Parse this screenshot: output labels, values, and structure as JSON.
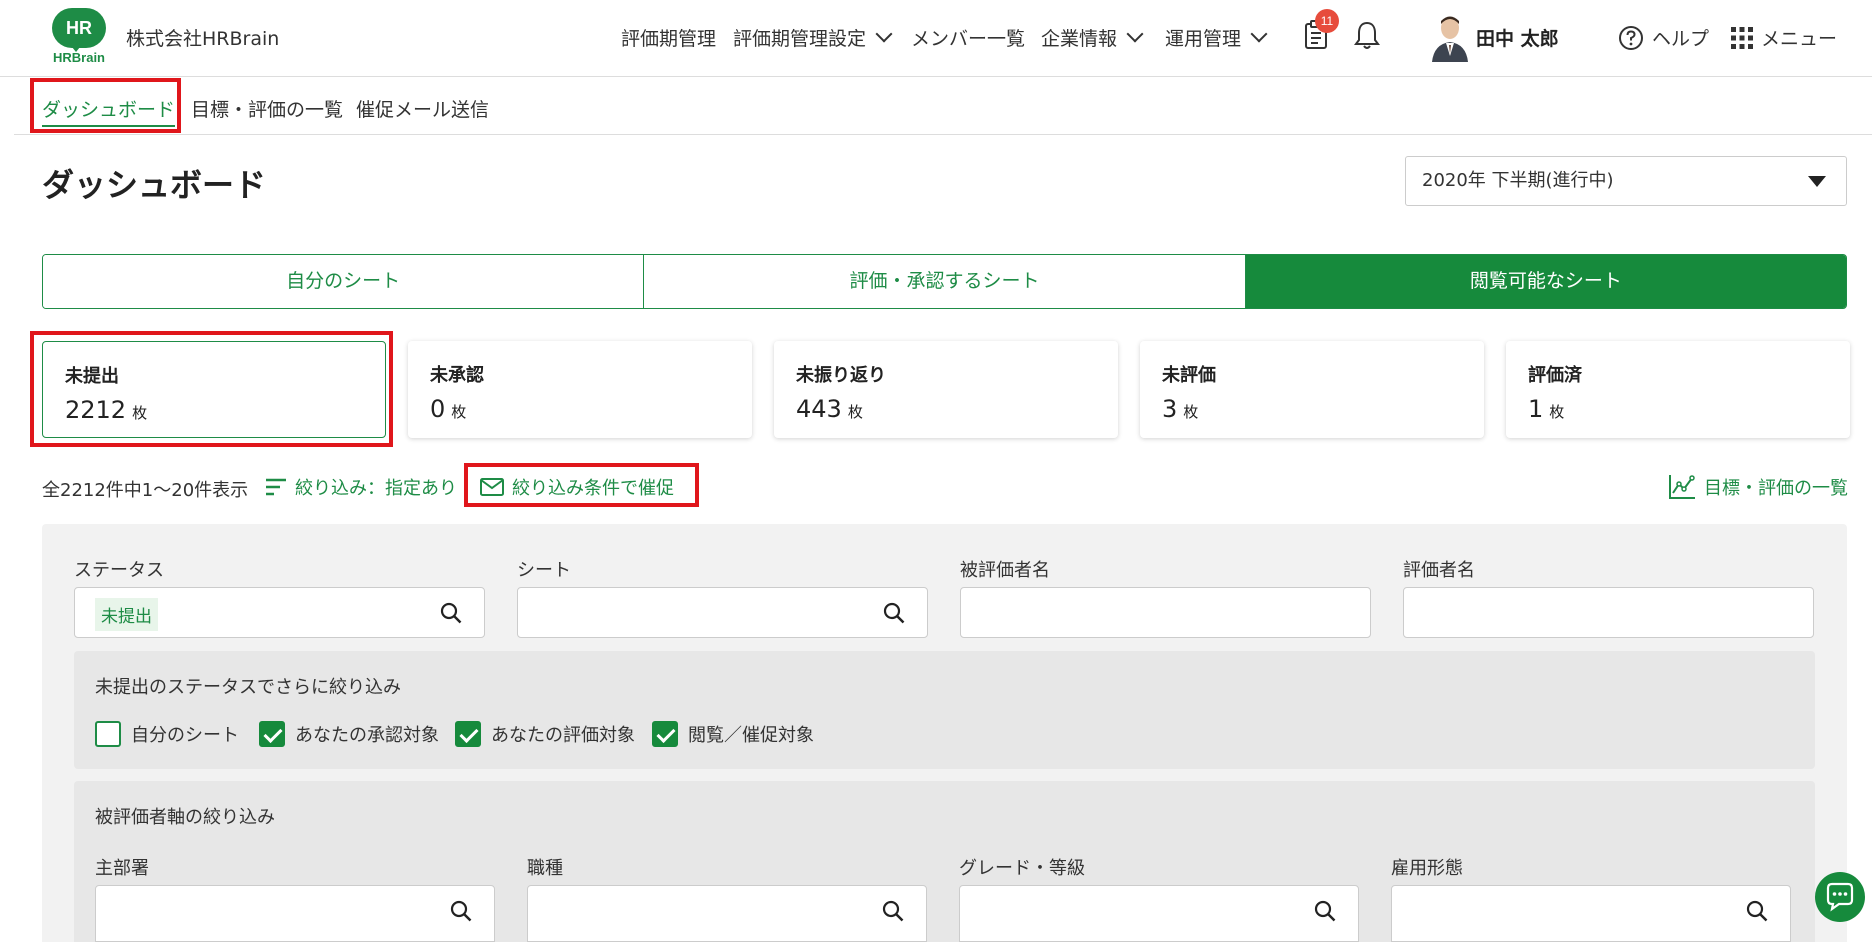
{
  "header": {
    "logo_text": "HR",
    "logo_sub": "HRBrain",
    "company": "株式会社HRBrain",
    "nav": [
      {
        "label": "評価期管理"
      },
      {
        "label": "評価期管理設定"
      },
      {
        "label": "メンバー一覧"
      },
      {
        "label": "企業情報"
      },
      {
        "label": "運用管理"
      }
    ],
    "notification_count": "11",
    "user_name": "田中 太郎",
    "help_label": "ヘルプ",
    "menu_label": "メニュー"
  },
  "subnav": {
    "items": [
      {
        "label": "ダッシュボード"
      },
      {
        "label": "目標・評価の一覧"
      },
      {
        "label": "催促メール送信"
      }
    ]
  },
  "page": {
    "title": "ダッシュボード",
    "period": "2020年 下半期(進行中)"
  },
  "tabs": [
    {
      "label": "自分のシート"
    },
    {
      "label": "評価・承認するシート"
    },
    {
      "label": "閲覧可能なシート"
    }
  ],
  "cards": [
    {
      "label": "未提出",
      "count": "2212",
      "unit": "枚"
    },
    {
      "label": "未承認",
      "count": "0",
      "unit": "枚"
    },
    {
      "label": "未振り返り",
      "count": "443",
      "unit": "枚"
    },
    {
      "label": "未評価",
      "count": "3",
      "unit": "枚"
    },
    {
      "label": "評価済",
      "count": "1",
      "unit": "枚"
    }
  ],
  "results": {
    "summary": "全2212件中1〜20件表示",
    "filter_label": "絞り込み：指定あり",
    "remind_label": "絞り込み条件で催促",
    "list_link": "目標・評価の一覧"
  },
  "filters": {
    "status_label": "ステータス",
    "status_chip": "未提出",
    "sheet_label": "シート",
    "evaluatee_label": "被評価者名",
    "evaluator_label": "評価者名",
    "sub_status_title": "未提出のステータスでさらに絞り込み",
    "checks": [
      {
        "label": "自分のシート",
        "checked": false
      },
      {
        "label": "あなたの承認対象",
        "checked": true
      },
      {
        "label": "あなたの評価対象",
        "checked": true
      },
      {
        "label": "閲覧／催促対象",
        "checked": true
      }
    ],
    "axis_title": "被評価者軸の絞り込み",
    "department_label": "主部署",
    "job_label": "職種",
    "grade_label": "グレード・等級",
    "employment_label": "雇用形態"
  },
  "colors": {
    "brand": "#1e8c46",
    "highlight": "#e0161b",
    "badge": "#e74c3c"
  }
}
